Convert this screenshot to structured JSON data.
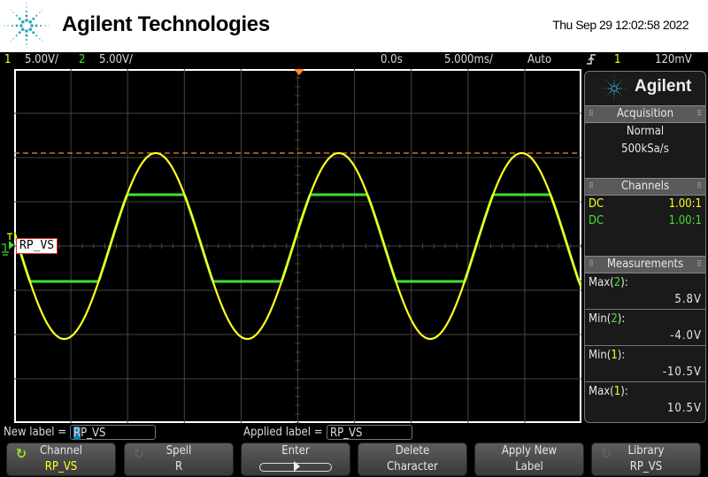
{
  "header": {
    "brand": "Agilent Technologies",
    "datetime": "Thu Sep 29 12:02:58 2022"
  },
  "status": {
    "ch1_num": "1",
    "ch1_scale": "5.00V/",
    "ch2_num": "2",
    "ch2_scale": "5.00V/",
    "time_offset": "0.0s",
    "time_scale": "5.000ms/",
    "trigger_mode": "Auto",
    "trigger_slope_icon": "rising-edge-icon",
    "trigger_source": "1",
    "trigger_level": "120mV"
  },
  "colors": {
    "ch1": "#ffff20",
    "ch2": "#40e030",
    "trigger": "#ff8a1c",
    "grid": "#444444"
  },
  "waveform": {
    "channel_label": "RP_VS",
    "ch1": {
      "amplitude_v": 10.5,
      "offset_v": 0.0,
      "type": "sine",
      "volts_per_div": 5.0
    },
    "ch2": {
      "max_v": 5.8,
      "min_v": -4.0,
      "type": "clipped-sine",
      "volts_per_div": 5.0
    },
    "cycles_on_screen": 3.1,
    "trigger_level_div": 2.1
  },
  "sidebar": {
    "logo": "Agilent",
    "acquisition": {
      "title": "Acquisition",
      "mode": "Normal",
      "rate": "500kSa/s"
    },
    "channels": {
      "title": "Channels",
      "rows": [
        {
          "coupling": "DC",
          "probe": "1.00:1"
        },
        {
          "coupling": "DC",
          "probe": "1.00:1"
        }
      ]
    },
    "measurements": {
      "title": "Measurements",
      "items": [
        {
          "name": "Max(",
          "ch": "2",
          "suffix": "):",
          "value": "5.8V"
        },
        {
          "name": "Min(",
          "ch": "2",
          "suffix": "):",
          "value": "-4.0V"
        },
        {
          "name": "Min(",
          "ch": "1",
          "suffix": "):",
          "value": "-10.5V"
        },
        {
          "name": "Max(",
          "ch": "1",
          "suffix": "):",
          "value": "10.5V"
        }
      ]
    }
  },
  "labelbar": {
    "new_label_caption": "New label =",
    "new_label_cursor_char": "R",
    "new_label_rest": "P_VS",
    "applied_label_caption": "Applied label =",
    "applied_label_value": "RP_VS"
  },
  "softkeys": [
    {
      "line1": "Channel",
      "line2": "RP_VS"
    },
    {
      "line1": "Spell",
      "line2": "R"
    },
    {
      "line1": "Enter",
      "line2": ""
    },
    {
      "line1": "Delete",
      "line2": "Character"
    },
    {
      "line1": "Apply New",
      "line2": "Label"
    },
    {
      "line1": "Library",
      "line2": "RP_VS"
    }
  ]
}
